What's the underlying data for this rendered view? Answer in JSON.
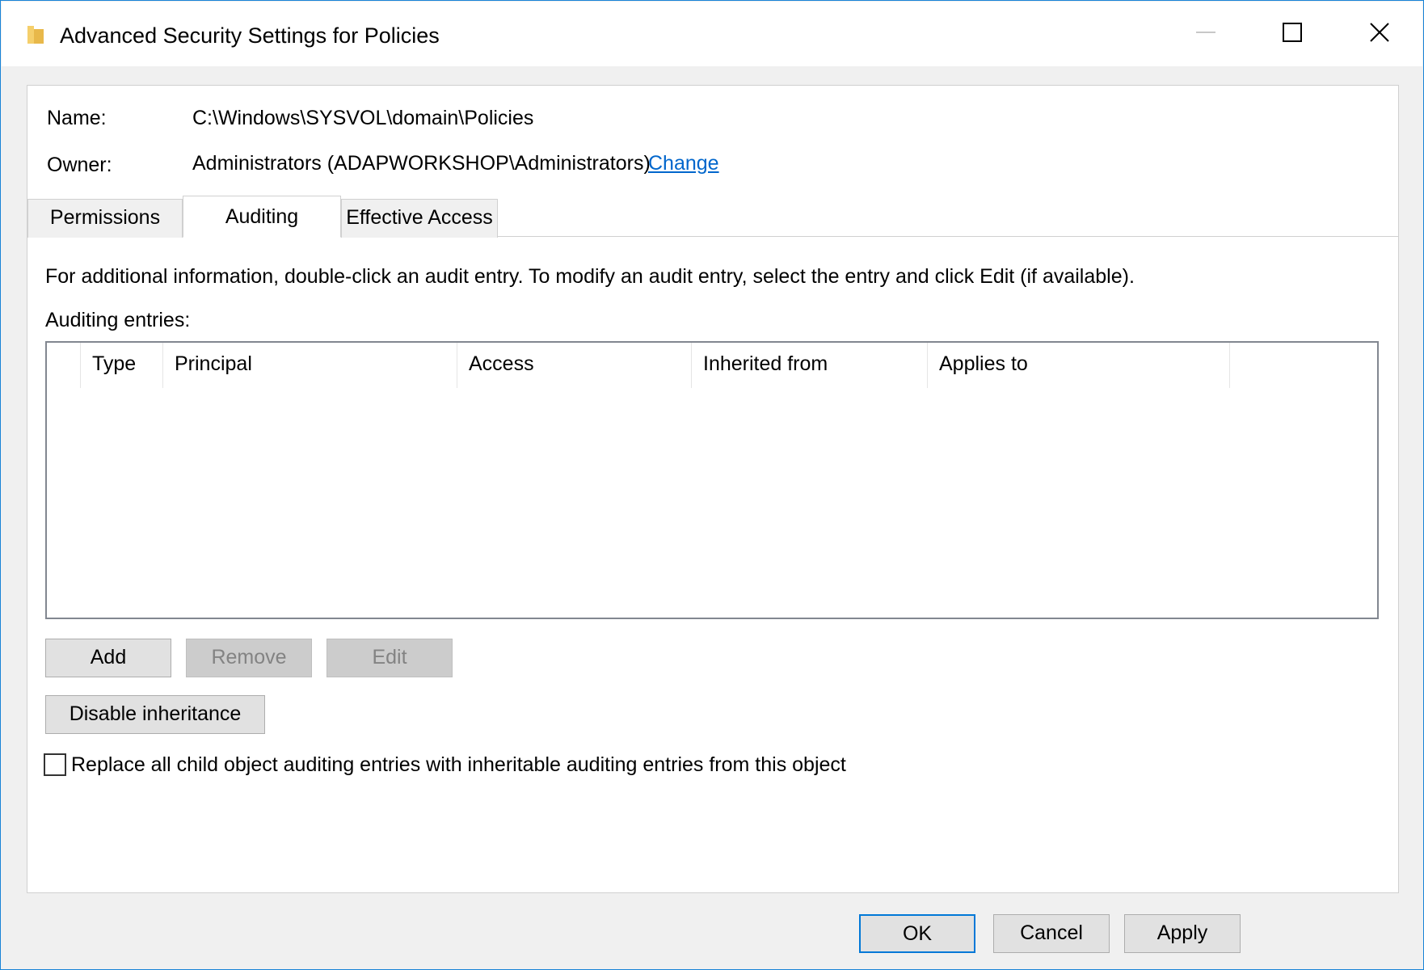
{
  "window": {
    "title": "Advanced Security Settings for Policies",
    "accent_color": "#1883d7"
  },
  "info": {
    "name_label": "Name:",
    "name_value": "C:\\Windows\\SYSVOL\\domain\\Policies",
    "owner_label": "Owner:",
    "owner_value": "Administrators (ADAPWORKSHOP\\Administrators)",
    "change_link": "Change"
  },
  "tabs": [
    {
      "label": "Permissions",
      "active": false
    },
    {
      "label": "Auditing",
      "active": true
    },
    {
      "label": "Effective Access",
      "active": false
    }
  ],
  "auditing": {
    "instructions": "For additional information, double-click an audit entry. To modify an audit entry, select the entry and click Edit (if available).",
    "entries_label": "Auditing entries:",
    "columns": [
      "Type",
      "Principal",
      "Access",
      "Inherited from",
      "Applies to"
    ],
    "rows": [],
    "add_button": "Add",
    "remove_button": "Remove",
    "edit_button": "Edit",
    "disable_inheritance_button": "Disable inheritance",
    "replace_checkbox_label": "Replace all child object auditing entries with inheritable auditing entries from this object",
    "replace_checked": false
  },
  "footer": {
    "ok": "OK",
    "cancel": "Cancel",
    "apply": "Apply"
  },
  "icons": {
    "title_icon": "folder-icon",
    "minimize": "minimize-icon",
    "maximize": "maximize-icon",
    "close": "close-icon"
  }
}
